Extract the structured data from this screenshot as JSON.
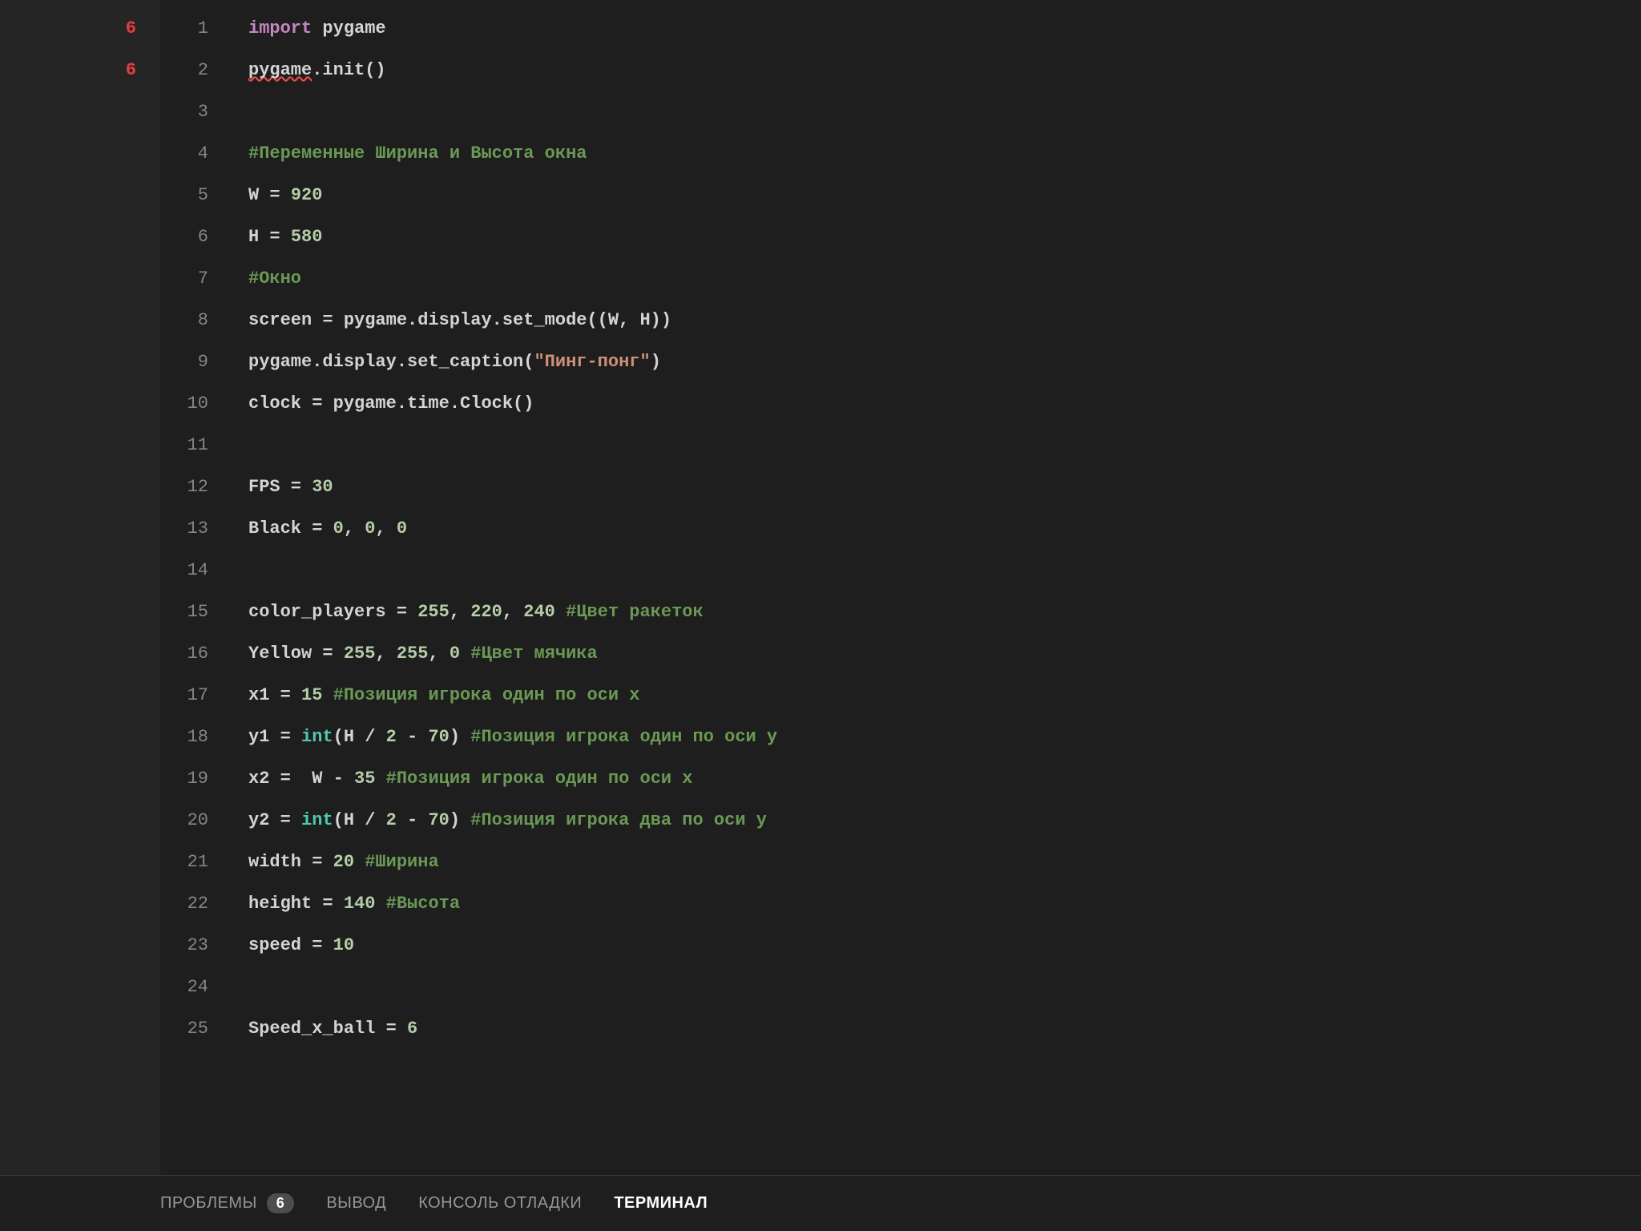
{
  "sidebar": {
    "markers": [
      "6",
      "",
      "6"
    ]
  },
  "code": {
    "start_line": 1,
    "lines": [
      [
        {
          "t": "keyword",
          "v": "import"
        },
        {
          "t": "plain",
          "v": " pygame"
        }
      ],
      [
        {
          "t": "squiggle",
          "v": "pygame"
        },
        {
          "t": "plain",
          "v": ".init()"
        }
      ],
      [],
      [
        {
          "t": "comment",
          "v": "#Переменные Ширина и Высота окна"
        }
      ],
      [
        {
          "t": "plain",
          "v": "W = "
        },
        {
          "t": "number",
          "v": "920"
        }
      ],
      [
        {
          "t": "plain",
          "v": "H = "
        },
        {
          "t": "number",
          "v": "580"
        }
      ],
      [
        {
          "t": "comment",
          "v": "#Окно"
        }
      ],
      [
        {
          "t": "plain",
          "v": "screen = pygame.display.set_mode((W, H))"
        }
      ],
      [
        {
          "t": "plain",
          "v": "pygame.display.set_caption("
        },
        {
          "t": "string",
          "v": "\"Пинг-понг\""
        },
        {
          "t": "plain",
          "v": ")"
        }
      ],
      [
        {
          "t": "plain",
          "v": "clock = pygame.time.Clock()"
        }
      ],
      [],
      [
        {
          "t": "plain",
          "v": "FPS = "
        },
        {
          "t": "number",
          "v": "30"
        }
      ],
      [
        {
          "t": "plain",
          "v": "Black = "
        },
        {
          "t": "number",
          "v": "0"
        },
        {
          "t": "plain",
          "v": ", "
        },
        {
          "t": "number",
          "v": "0"
        },
        {
          "t": "plain",
          "v": ", "
        },
        {
          "t": "number",
          "v": "0"
        }
      ],
      [],
      [
        {
          "t": "plain",
          "v": "color_players = "
        },
        {
          "t": "number",
          "v": "255"
        },
        {
          "t": "plain",
          "v": ", "
        },
        {
          "t": "number",
          "v": "220"
        },
        {
          "t": "plain",
          "v": ", "
        },
        {
          "t": "number",
          "v": "240"
        },
        {
          "t": "plain",
          "v": " "
        },
        {
          "t": "comment",
          "v": "#Цвет ракеток"
        }
      ],
      [
        {
          "t": "plain",
          "v": "Yellow = "
        },
        {
          "t": "number",
          "v": "255"
        },
        {
          "t": "plain",
          "v": ", "
        },
        {
          "t": "number",
          "v": "255"
        },
        {
          "t": "plain",
          "v": ", "
        },
        {
          "t": "number",
          "v": "0"
        },
        {
          "t": "plain",
          "v": " "
        },
        {
          "t": "comment",
          "v": "#Цвет мячика"
        }
      ],
      [
        {
          "t": "plain",
          "v": "x1 = "
        },
        {
          "t": "number",
          "v": "15"
        },
        {
          "t": "plain",
          "v": " "
        },
        {
          "t": "comment",
          "v": "#Позиция игрока один по оси х"
        }
      ],
      [
        {
          "t": "plain",
          "v": "y1 = "
        },
        {
          "t": "type",
          "v": "int"
        },
        {
          "t": "plain",
          "v": "(H / "
        },
        {
          "t": "number",
          "v": "2"
        },
        {
          "t": "plain",
          "v": " - "
        },
        {
          "t": "number",
          "v": "70"
        },
        {
          "t": "plain",
          "v": ") "
        },
        {
          "t": "comment",
          "v": "#Позиция игрока один по оси у"
        }
      ],
      [
        {
          "t": "plain",
          "v": "x2 =  W - "
        },
        {
          "t": "number",
          "v": "35"
        },
        {
          "t": "plain",
          "v": " "
        },
        {
          "t": "comment",
          "v": "#Позиция игрока один по оси х"
        }
      ],
      [
        {
          "t": "plain",
          "v": "y2 = "
        },
        {
          "t": "type",
          "v": "int"
        },
        {
          "t": "plain",
          "v": "(H / "
        },
        {
          "t": "number",
          "v": "2"
        },
        {
          "t": "plain",
          "v": " - "
        },
        {
          "t": "number",
          "v": "70"
        },
        {
          "t": "plain",
          "v": ") "
        },
        {
          "t": "comment",
          "v": "#Позиция игрока два по оси у"
        }
      ],
      [
        {
          "t": "plain",
          "v": "width = "
        },
        {
          "t": "number",
          "v": "20"
        },
        {
          "t": "plain",
          "v": " "
        },
        {
          "t": "comment",
          "v": "#Ширина"
        }
      ],
      [
        {
          "t": "plain",
          "v": "height = "
        },
        {
          "t": "number",
          "v": "140"
        },
        {
          "t": "plain",
          "v": " "
        },
        {
          "t": "comment",
          "v": "#Высота"
        }
      ],
      [
        {
          "t": "plain",
          "v": "speed = "
        },
        {
          "t": "number",
          "v": "10"
        }
      ],
      [],
      [
        {
          "t": "plain",
          "v": "Speed_x_ball = "
        },
        {
          "t": "number",
          "v": "6"
        }
      ]
    ]
  },
  "panel": {
    "tabs": [
      {
        "label": "ПРОБЛЕМЫ",
        "badge": "6",
        "active": false
      },
      {
        "label": "ВЫВОД",
        "active": false
      },
      {
        "label": "КОНСОЛЬ ОТЛАДКИ",
        "active": false
      },
      {
        "label": "ТЕРМИНАЛ",
        "active": true
      }
    ]
  }
}
